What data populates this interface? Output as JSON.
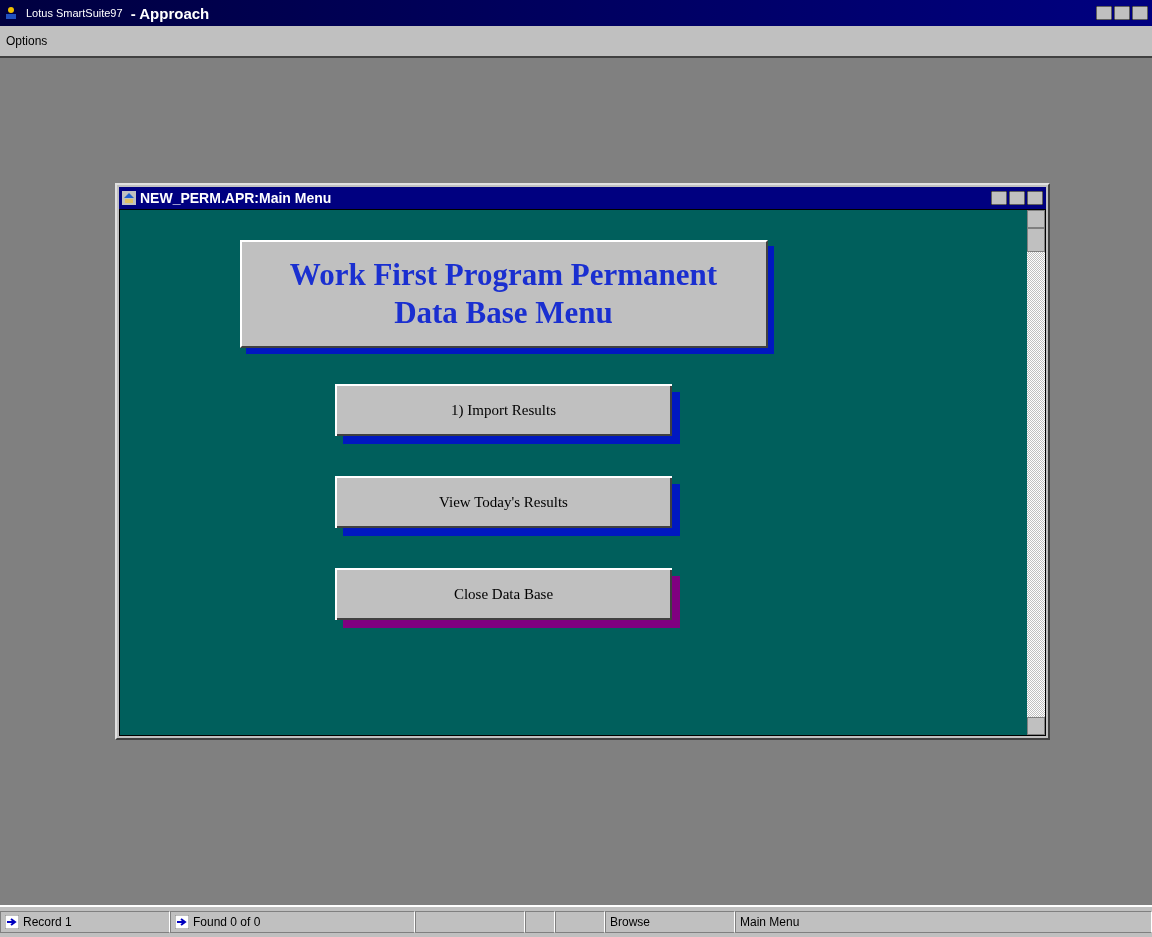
{
  "window": {
    "title": "Lotus SmartSuite97",
    "app": "- Approach"
  },
  "menu": [
    "Options"
  ],
  "document": {
    "title": "NEW_PERM.APR:Main Menu",
    "heading": [
      "Work First Program Permanent",
      "Data Base Menu"
    ],
    "buttons": [
      {
        "label": "1) Import Results",
        "color": "#0018c0"
      },
      {
        "label": "View Today's Results",
        "color": "#0018c0"
      },
      {
        "label": "Close Data Base",
        "color": "#800080"
      }
    ]
  },
  "status_bar": {
    "record": "Record 1",
    "found": "Found 0 of 0",
    "mode": "Browse",
    "view": "Main Menu"
  }
}
